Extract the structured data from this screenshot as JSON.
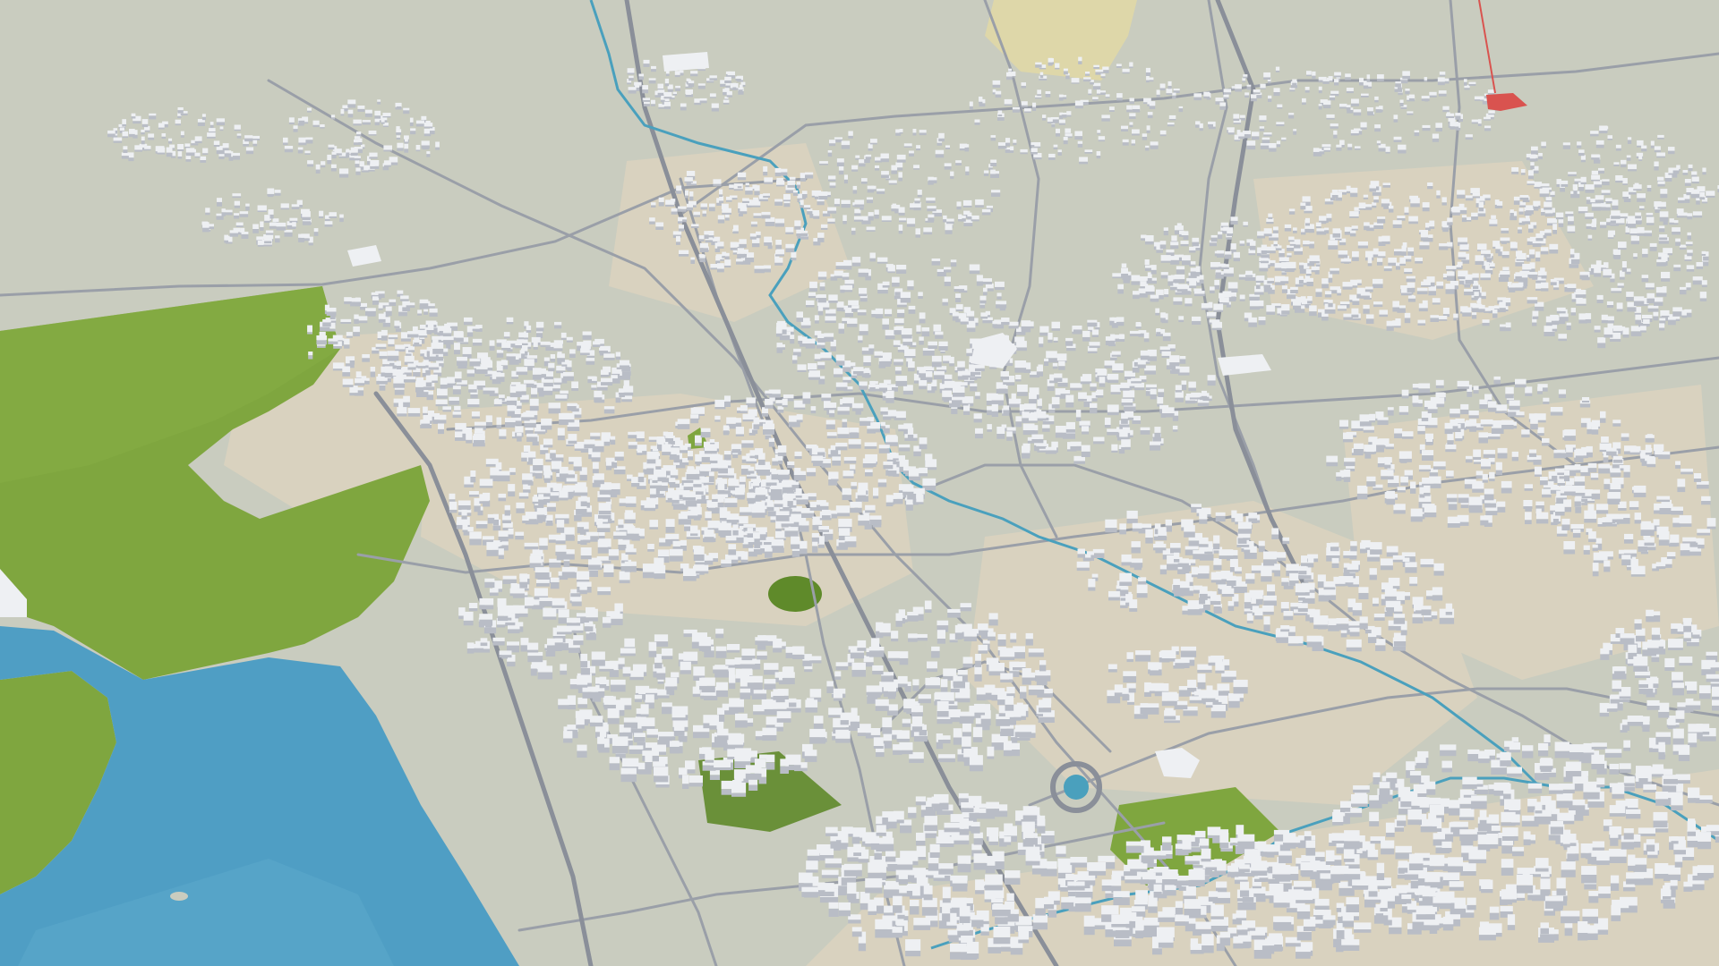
{
  "map": {
    "kind": "3d-city-model",
    "palette": {
      "ground": "#c9ccbf",
      "ground_dense": "#d9d2bf",
      "sand": "#ddd3bb",
      "forest": "#7fa63f",
      "forest_dark": "#5f8a2a",
      "water": "#4f9ec4",
      "water_light": "#7cc0dc",
      "road": "#9a9fa8",
      "road_major": "#8a8f99",
      "building": "#eef0f3",
      "building_shade": "#b9bdc6",
      "river": "#4aa0bd",
      "highlight_red": "#d9534f",
      "highlight_yellow": "#e3d9a4"
    },
    "layers": [
      "terrain",
      "water",
      "forest",
      "roads",
      "river",
      "buildings",
      "parks"
    ]
  }
}
